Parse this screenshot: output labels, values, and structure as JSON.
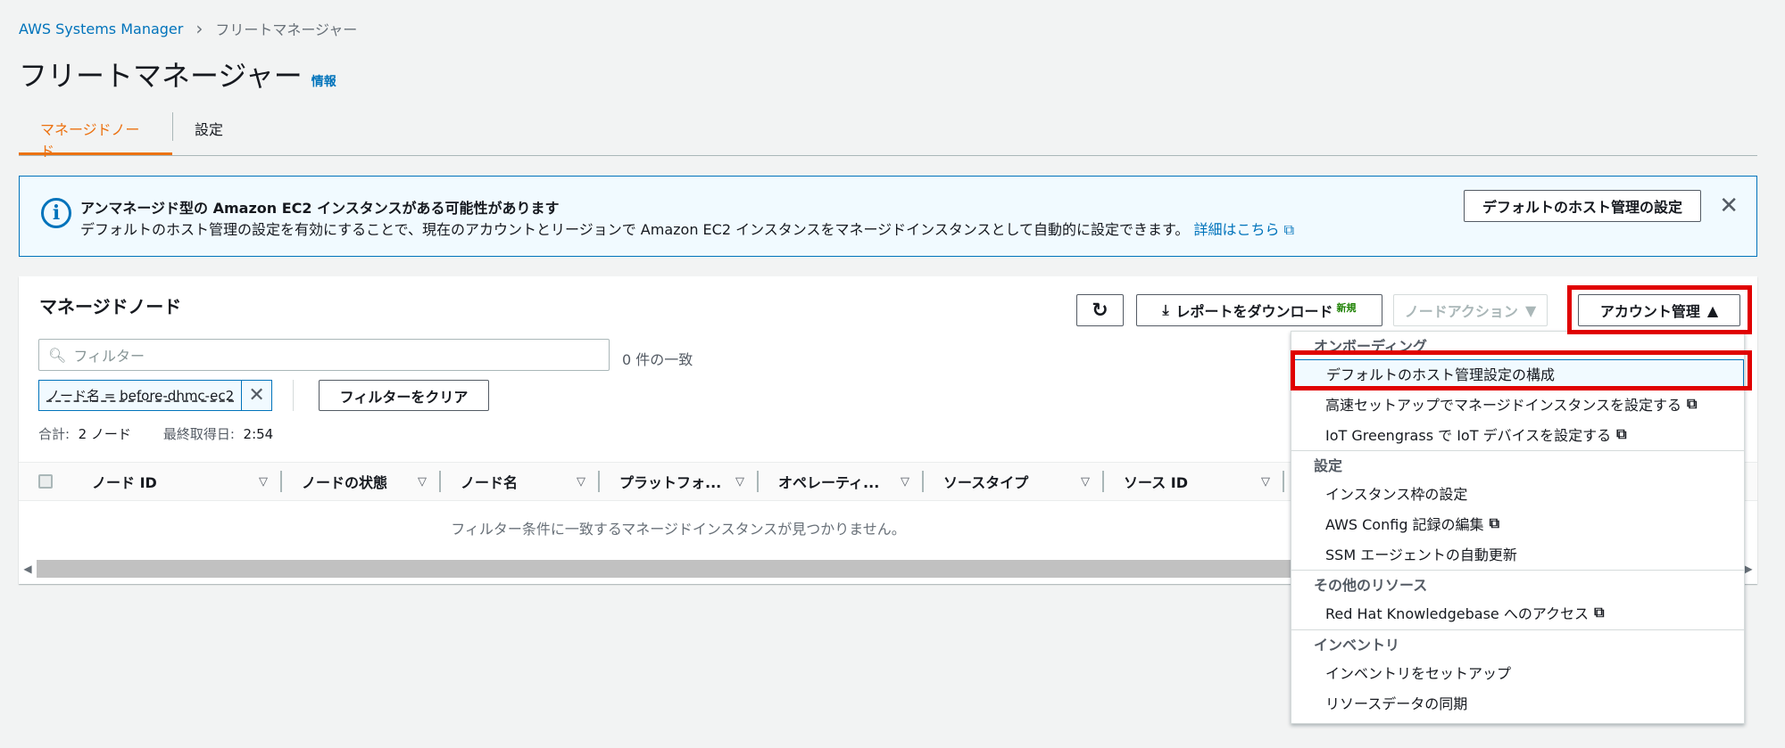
{
  "breadcrumb": {
    "root": "AWS Systems Manager",
    "current": "フリートマネージャー"
  },
  "page": {
    "title": "フリートマネージャー",
    "info": "情報"
  },
  "tabs": [
    {
      "label": "マネージドノード"
    },
    {
      "label": "設定"
    }
  ],
  "banner": {
    "icon": "info-icon",
    "title": "アンマネージド型の Amazon EC2 インスタンスがある可能性があります",
    "desc": "デフォルトのホスト管理の設定を有効にすることで、現在のアカウントとリージョンで Amazon EC2 インスタンスをマネージドインスタンスとして自動的に設定できます。",
    "more": "詳細はこちら",
    "button": "デフォルトのホスト管理の設定"
  },
  "panel": {
    "title": "マネージドノード",
    "download": "レポートをダウンロード",
    "new": "新規",
    "node_action": "ノードアクション",
    "account": "アカウント管理",
    "filter_placeholder": "フィルター",
    "match_count": "0 件の一致",
    "token": "ノード名 = before-dhmc-ec2",
    "clear": "フィルターをクリア",
    "total_label": "合計:",
    "total_value": "2 ノード",
    "fetched_label": "最終取得日:",
    "fetched_value": "2:54",
    "columns": [
      "ノード ID",
      "ノードの状態",
      "ノード名",
      "プラットフォ...",
      "オペレーティ...",
      "ソースタイプ",
      "ソース ID"
    ],
    "empty": "フィルター条件に一致するマネージドインスタンスが見つかりません。"
  },
  "dropdown": {
    "groups": [
      {
        "head": "オンボーディング",
        "items": [
          "デフォルトのホスト管理設定の構成",
          "高速セットアップでマネージドインスタンスを設定する",
          "IoT Greengrass で IoT デバイスを設定する"
        ]
      },
      {
        "head": "設定",
        "items": [
          "インスタンス枠の設定",
          "AWS Config 記録の編集",
          "SSM エージェントの自動更新"
        ]
      },
      {
        "head": "その他のリソース",
        "items": [
          "Red Hat Knowledgebase へのアクセス"
        ]
      },
      {
        "head": "インベントリ",
        "items": [
          "インベントリをセットアップ",
          "リソースデータの同期"
        ]
      }
    ]
  }
}
